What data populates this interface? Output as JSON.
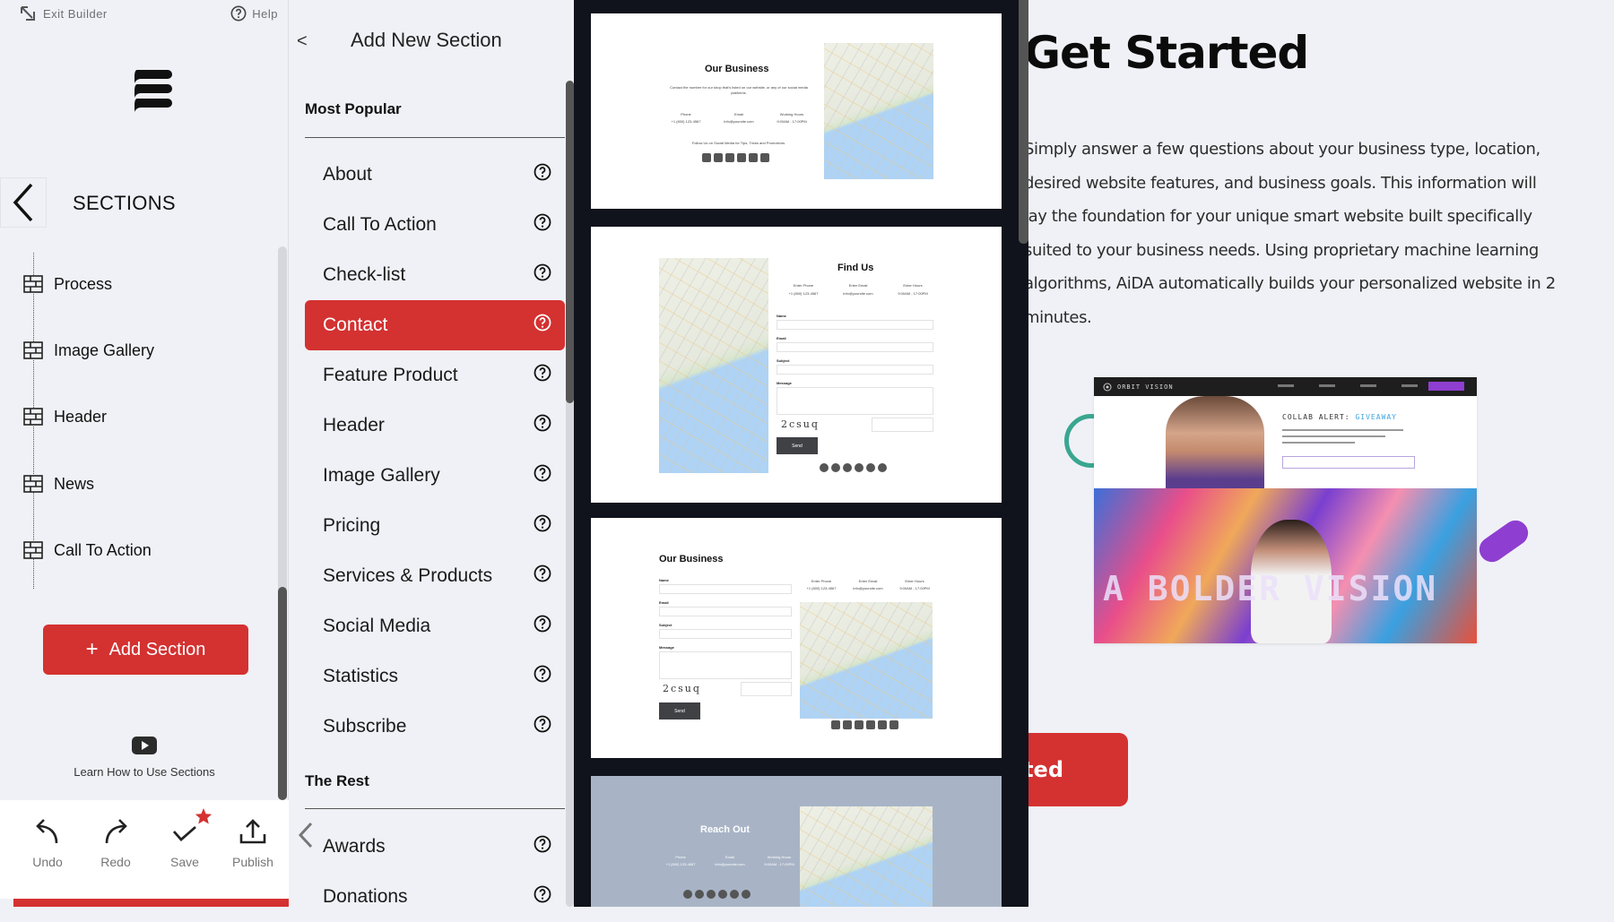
{
  "topbar": {
    "exit_label": "Exit Builder",
    "help_label": "Help"
  },
  "sections_panel": {
    "title": "SECTIONS",
    "items": [
      {
        "label": "Process"
      },
      {
        "label": "Image Gallery"
      },
      {
        "label": "Header"
      },
      {
        "label": "News"
      },
      {
        "label": "Call To Action"
      }
    ],
    "add_button": "Add Section",
    "learn_link": "Learn How to Use Sections"
  },
  "toolbar": {
    "undo": "Undo",
    "redo": "Redo",
    "save": "Save",
    "publish": "Publish"
  },
  "add_panel": {
    "back": "<",
    "title": "Add New Section",
    "groups": [
      {
        "title": "Most Popular",
        "options": [
          {
            "label": "About",
            "active": false
          },
          {
            "label": "Call To Action",
            "active": false
          },
          {
            "label": "Check-list",
            "active": false
          },
          {
            "label": "Contact",
            "active": true
          },
          {
            "label": "Feature Product",
            "active": false
          },
          {
            "label": "Header",
            "active": false
          },
          {
            "label": "Image Gallery",
            "active": false
          },
          {
            "label": "Pricing",
            "active": false
          },
          {
            "label": "Services & Products",
            "active": false
          },
          {
            "label": "Social Media",
            "active": false
          },
          {
            "label": "Statistics",
            "active": false
          },
          {
            "label": "Subscribe",
            "active": false
          }
        ]
      },
      {
        "title": "The Rest",
        "options": [
          {
            "label": "Awards",
            "active": false
          },
          {
            "label": "Donations",
            "active": false
          }
        ]
      }
    ]
  },
  "previews": [
    {
      "title": "Our Business",
      "description": "Contact the number for our shop that's listed on our website, or any of our social media platforms.",
      "contacts": [
        {
          "label": "Phone",
          "value": "+1 (800) 123-4567"
        },
        {
          "label": "Email",
          "value": "info@yoursite.com"
        },
        {
          "label": "Working Hours",
          "value": "9:00AM - 17:00PM"
        }
      ],
      "follow": "Follow Us on Social Media for Tips, Tricks and Promotions."
    },
    {
      "title": "Find Us",
      "contacts": [
        {
          "label": "Enter Phone",
          "value": "+1 (800) 123-4567"
        },
        {
          "label": "Enter Email",
          "value": "info@yoursite.com"
        },
        {
          "label": "Enter Hours",
          "value": "9:00AM - 17:00PM"
        }
      ],
      "fields": [
        "Name",
        "Email",
        "Subject",
        "Message"
      ],
      "captcha": "2csuq",
      "send": "Send"
    },
    {
      "title": "Our Business",
      "contacts": [
        {
          "label": "Enter Phone",
          "value": "+1 (800) 123-4567"
        },
        {
          "label": "Enter Email",
          "value": "info@yoursite.com"
        },
        {
          "label": "Enter Hours",
          "value": "9:00AM - 17:00PM"
        }
      ],
      "fields": [
        "Name",
        "Email",
        "Subject",
        "Message"
      ],
      "captcha": "2csuq",
      "send": "Send"
    },
    {
      "title": "Reach Out",
      "contacts": [
        {
          "label": "Phone",
          "value": "+1 (800) 123-4567"
        },
        {
          "label": "Email",
          "value": "info@yoursite.com"
        },
        {
          "label": "Working Hours",
          "value": "9:00AM - 17:00PM"
        }
      ]
    }
  ],
  "content": {
    "title": "Get Started",
    "paragraph": "Simply answer a few questions about your business type, location, desired website features, and business goals. This information will lay the foundation for your unique smart website built specifically suited to your business needs. Using proprietary machine learning algorithms, AiDA automatically builds your personalized website in 2 minutes.",
    "mockup": {
      "brand": "ORBIT VISION",
      "headline": "COLLAB ALERT:",
      "headline_highlight": "GIVEAWAY",
      "hero_text": "A BOLDER VISION"
    },
    "cta_button": "Get Started"
  },
  "colors": {
    "accent": "#d43131",
    "panel_bg": "#f0f1f6",
    "preview_bg": "#10121c",
    "purple": "#8e3ed0",
    "teal": "#3aa690"
  }
}
